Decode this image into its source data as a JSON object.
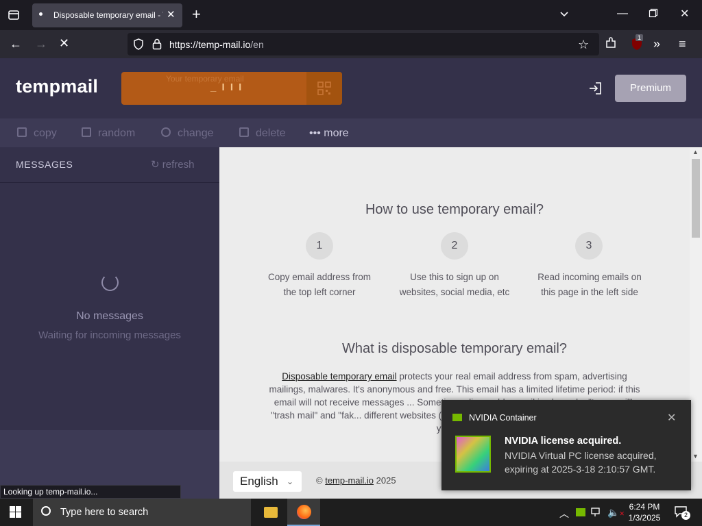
{
  "browser": {
    "tab_title": "Disposable temporary email - T",
    "url_host": "https://temp-mail.io",
    "url_path": "/en",
    "extension_badge": "1",
    "status_text": "Looking up temp-mail.io..."
  },
  "site": {
    "logo": "tempmail",
    "email_label": "Your temporary email",
    "email_loading": "_ I I I",
    "premium_label": "Premium",
    "toolbar": {
      "copy": "copy",
      "random": "random",
      "change": "change",
      "delete": "delete",
      "more": "••• more"
    },
    "sidebar": {
      "title": "MESSAGES",
      "refresh": "refresh",
      "empty_title": "No messages",
      "empty_sub": "Waiting for incoming messages"
    },
    "main": {
      "how_title": "How to use temporary email?",
      "steps": [
        {
          "num": "1",
          "text": "Copy email address from the top left corner"
        },
        {
          "num": "2",
          "text": "Use this to sign up on websites, social media, etc"
        },
        {
          "num": "3",
          "text": "Read incoming emails on this page in the left side"
        }
      ],
      "what_title": "What is disposable temporary email?",
      "para_link": "Disposable temporary email",
      "para_text": " protects your real email address from spam, advertising mailings, malwares. It's anonymous and free. This email has a limited lifetime period: if this email will not receive messages ... Sometimes disposable email is also cal... \"tempmail\", \"trash mail\" and \"fak... different websites (e.g. social networ... each time you want to stash your real"
    },
    "footer": {
      "language": "English",
      "copyright_prefix": "©",
      "copyright_link": "temp-mail.io",
      "copyright_year": "2025"
    }
  },
  "notification": {
    "app": "NVIDIA Container",
    "title": "NVIDIA license acquired.",
    "body": "NVIDIA Virtual PC license acquired, expiring at 2025-3-18 2:10:57 GMT."
  },
  "taskbar": {
    "search_placeholder": "Type here to search",
    "time": "6:24 PM",
    "date": "1/3/2025",
    "notification_count": "2"
  },
  "colors": {
    "header_bg": "#34314a",
    "email_box": "#b35a17",
    "nvidia_green": "#76b900"
  }
}
